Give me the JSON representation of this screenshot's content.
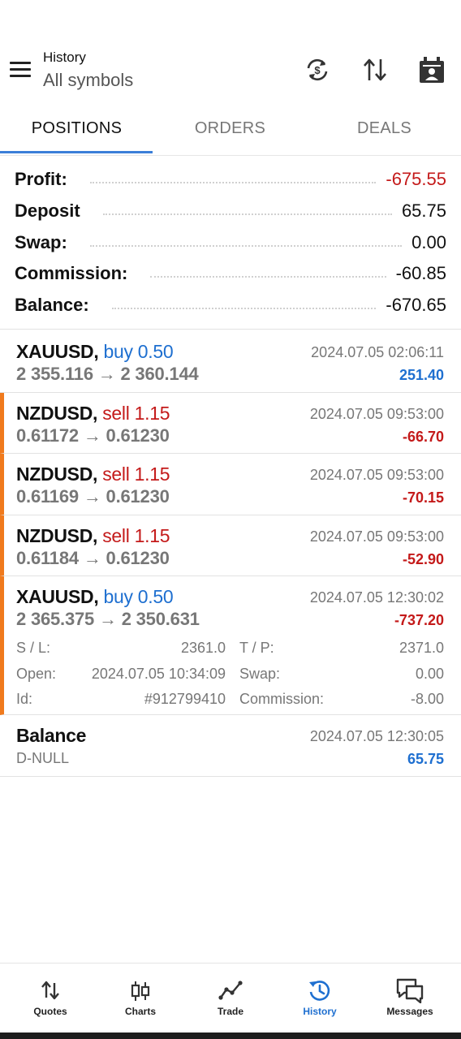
{
  "header": {
    "title": "History",
    "subtitle": "All symbols"
  },
  "tabs": [
    {
      "label": "POSITIONS",
      "active": true
    },
    {
      "label": "ORDERS",
      "active": false
    },
    {
      "label": "DEALS",
      "active": false
    }
  ],
  "summary": {
    "profit_label": "Profit:",
    "profit_value": "-675.55",
    "deposit_label": "Deposit",
    "deposit_value": "65.75",
    "swap_label": "Swap:",
    "swap_value": "0.00",
    "commission_label": "Commission:",
    "commission_value": "-60.85",
    "balance_label": "Balance:",
    "balance_value": "-670.65"
  },
  "deals": [
    {
      "symbol": "XAUUSD,",
      "side": "buy 0.50",
      "prices": "2 355.116 → 2 360.144",
      "time": "2024.07.05 02:06:11",
      "profit": "251.40"
    },
    {
      "symbol": "NZDUSD,",
      "side": "sell 1.15",
      "prices": "0.61172 → 0.61230",
      "time": "2024.07.05 09:53:00",
      "profit": "-66.70"
    },
    {
      "symbol": "NZDUSD,",
      "side": "sell 1.15",
      "prices": "0.61169 → 0.61230",
      "time": "2024.07.05 09:53:00",
      "profit": "-70.15"
    },
    {
      "symbol": "NZDUSD,",
      "side": "sell 1.15",
      "prices": "0.61184 → 0.61230",
      "time": "2024.07.05 09:53:00",
      "profit": "-52.90"
    },
    {
      "symbol": "XAUUSD,",
      "side": "buy 0.50",
      "prices": "2 365.375 → 2 350.631",
      "time": "2024.07.05 12:30:02",
      "profit": "-737.20"
    }
  ],
  "expanded": {
    "sl_label": "S / L:",
    "sl_value": "2361.0",
    "tp_label": "T / P:",
    "tp_value": "2371.0",
    "open_label": "Open:",
    "open_value": "2024.07.05 10:34:09",
    "swap_label": "Swap:",
    "swap_value": "0.00",
    "id_label": "Id:",
    "id_value": "#912799410",
    "commission_label": "Commission:",
    "commission_value": "-8.00"
  },
  "balance_op": {
    "title": "Balance",
    "comment": "D-NULL",
    "time": "2024.07.05 12:30:05",
    "amount": "65.75"
  },
  "nav": [
    {
      "label": "Quotes",
      "icon": "quotes-icon"
    },
    {
      "label": "Charts",
      "icon": "charts-icon"
    },
    {
      "label": "Trade",
      "icon": "trade-icon"
    },
    {
      "label": "History",
      "icon": "history-icon",
      "active": true
    },
    {
      "label": "Messages",
      "icon": "messages-icon"
    }
  ],
  "colors": {
    "accent_blue": "#1e6fd0",
    "loss_red": "#c41a1a",
    "marker_orange": "#f07a1d"
  }
}
